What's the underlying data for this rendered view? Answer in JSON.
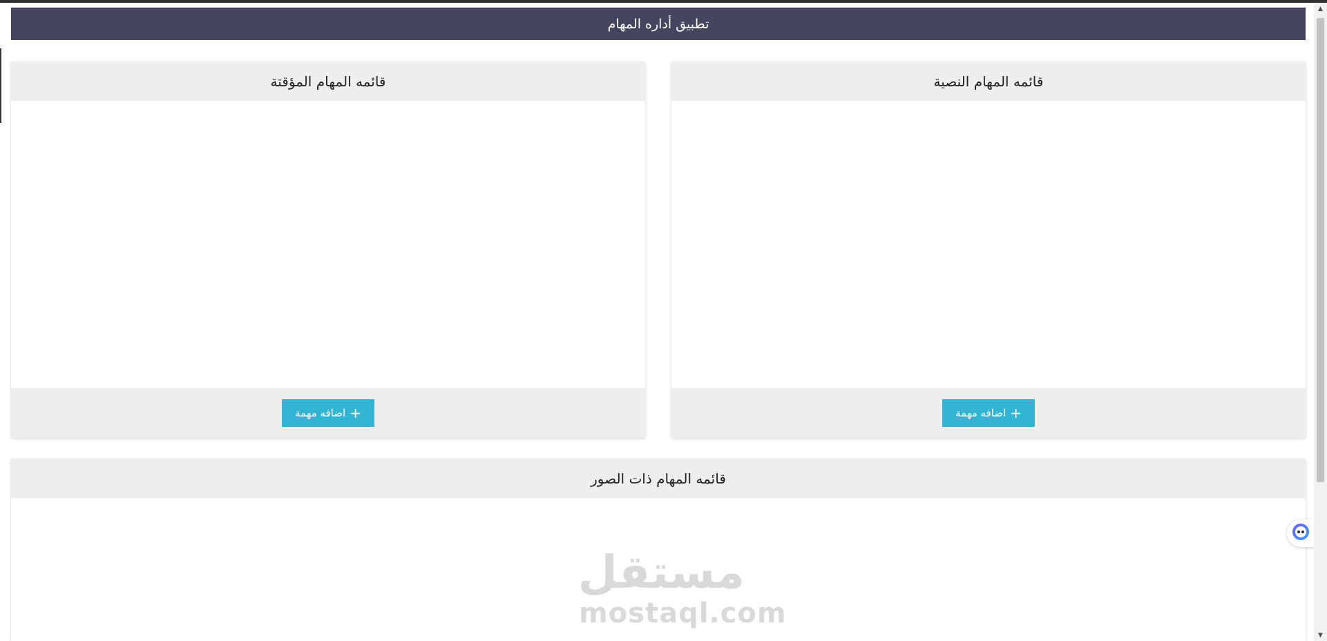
{
  "app": {
    "title": "تطبيق أداره المهام"
  },
  "lists": {
    "text_tasks": {
      "title": "قائمه المهام النصية",
      "add_label": "اضافه مهمة"
    },
    "timed_tasks": {
      "title": "قائمه المهام المؤقتة",
      "add_label": "اضافه مهمة"
    },
    "image_tasks": {
      "title": "قائمه المهام ذات الصور"
    }
  },
  "watermark": {
    "arabic": "مستقل",
    "latin": "mostaql.com"
  },
  "colors": {
    "header_bg": "#454560",
    "card_header_bg": "#eeeeee",
    "button_bg": "#31b5d2"
  },
  "icons": {
    "add": "plus-icon",
    "assistant": "assistant-bot-icon"
  }
}
